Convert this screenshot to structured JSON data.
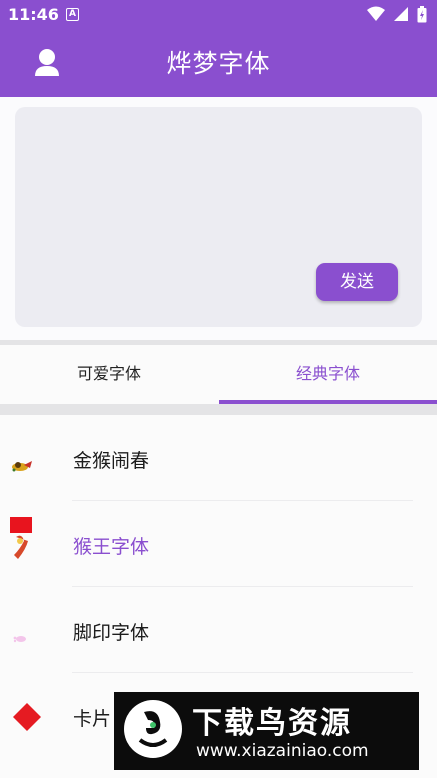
{
  "status_bar": {
    "time": "11:46",
    "notification_letter": "A"
  },
  "header": {
    "title": "烨梦字体",
    "avatar_icon": "user-icon"
  },
  "composer": {
    "send_label": "发送",
    "text_value": ""
  },
  "tabs": [
    {
      "label": "可爱字体",
      "active": false
    },
    {
      "label": "经典字体",
      "active": true
    }
  ],
  "font_list": [
    {
      "label": "金猴闹春",
      "icon": "monkey-sticker-icon",
      "selected": false
    },
    {
      "label": "猴王字体",
      "icon": "monkey-king-sticker-icon",
      "selected": true
    },
    {
      "label": "脚印字体",
      "icon": "footprint-icon",
      "selected": false
    },
    {
      "label": "卡片",
      "icon": "red-card-icon",
      "selected": false
    }
  ],
  "watermark": {
    "title": "下载鸟资源",
    "url": "www.xiazainiao.com"
  },
  "colors": {
    "accent": "#8a4fcf",
    "input_bg": "#ececf2",
    "selected_text": "#8a4fcf"
  }
}
